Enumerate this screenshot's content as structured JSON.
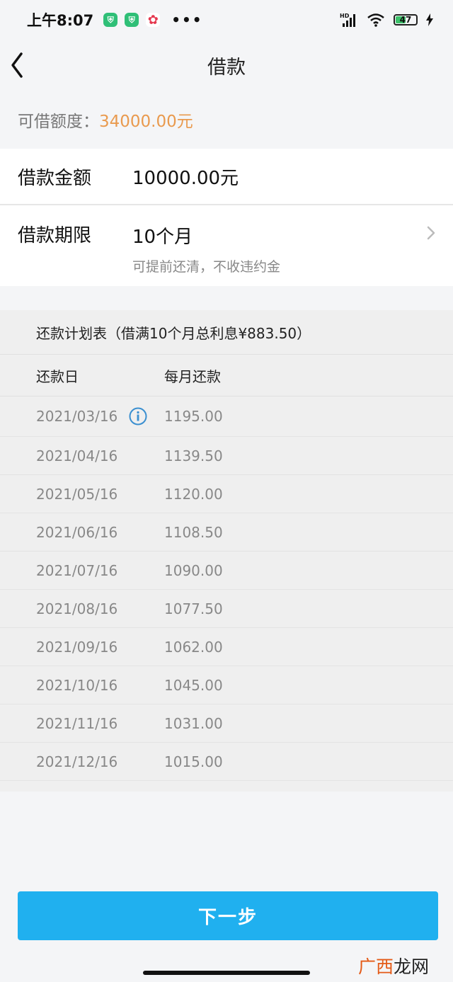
{
  "status_bar": {
    "time": "上午8:07",
    "network": "HD",
    "battery": "47"
  },
  "nav": {
    "title": "借款"
  },
  "limit": {
    "label": "可借额度：",
    "value": "34000.00元"
  },
  "amount": {
    "label": "借款金额",
    "value": "10000.00元"
  },
  "term": {
    "label": "借款期限",
    "value": "10个月",
    "note": "可提前还清，不收违约金"
  },
  "schedule": {
    "title": "还款计划表（借满10个月总利息¥883.50）",
    "col_date": "还款日",
    "col_amount": "每月还款",
    "rows": [
      {
        "date": "2021/03/16",
        "amount": "1195.00"
      },
      {
        "date": "2021/04/16",
        "amount": "1139.50"
      },
      {
        "date": "2021/05/16",
        "amount": "1120.00"
      },
      {
        "date": "2021/06/16",
        "amount": "1108.50"
      },
      {
        "date": "2021/07/16",
        "amount": "1090.00"
      },
      {
        "date": "2021/08/16",
        "amount": "1077.50"
      },
      {
        "date": "2021/09/16",
        "amount": "1062.00"
      },
      {
        "date": "2021/10/16",
        "amount": "1045.00"
      },
      {
        "date": "2021/11/16",
        "amount": "1031.00"
      },
      {
        "date": "2021/12/16",
        "amount": "1015.00"
      }
    ]
  },
  "next_button": "下一步",
  "watermark": {
    "part1": "广西",
    "part2": "龙网"
  },
  "colors": {
    "accent": "#20b0ef",
    "limit_value": "#e99a4e",
    "info_icon": "#3a8fd0"
  }
}
